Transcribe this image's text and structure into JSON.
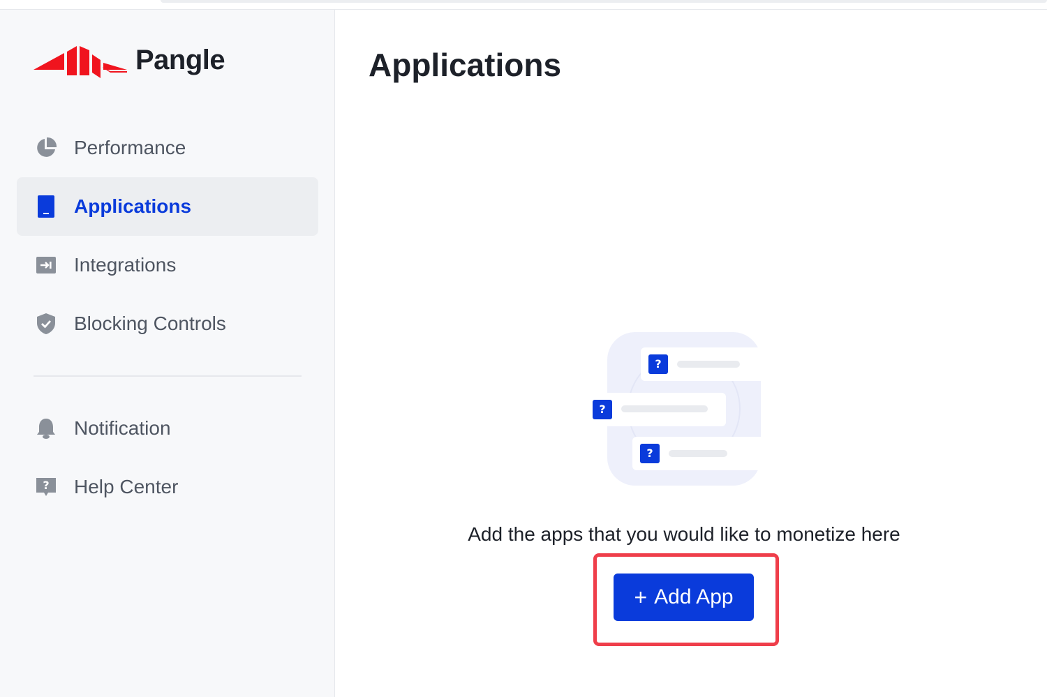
{
  "brand": {
    "name": "Pangle"
  },
  "sidebar": {
    "items": [
      {
        "label": "Performance",
        "icon": "pie-chart-icon"
      },
      {
        "label": "Applications",
        "icon": "phone-icon",
        "active": true
      },
      {
        "label": "Integrations",
        "icon": "integration-icon"
      },
      {
        "label": "Blocking Controls",
        "icon": "shield-icon"
      }
    ],
    "secondary": [
      {
        "label": "Notification",
        "icon": "bell-icon"
      },
      {
        "label": "Help Center",
        "icon": "help-icon"
      }
    ]
  },
  "main": {
    "title": "Applications",
    "empty_state": {
      "message": "Add the apps that you would like to monetize here",
      "illustration_marks": [
        "?",
        "?",
        "?"
      ],
      "button": {
        "plus": "+",
        "label": "Add App"
      }
    }
  },
  "colors": {
    "accent": "#0a3bdb",
    "brand_red": "#f0141e",
    "highlight_red": "#ef3e4a"
  }
}
